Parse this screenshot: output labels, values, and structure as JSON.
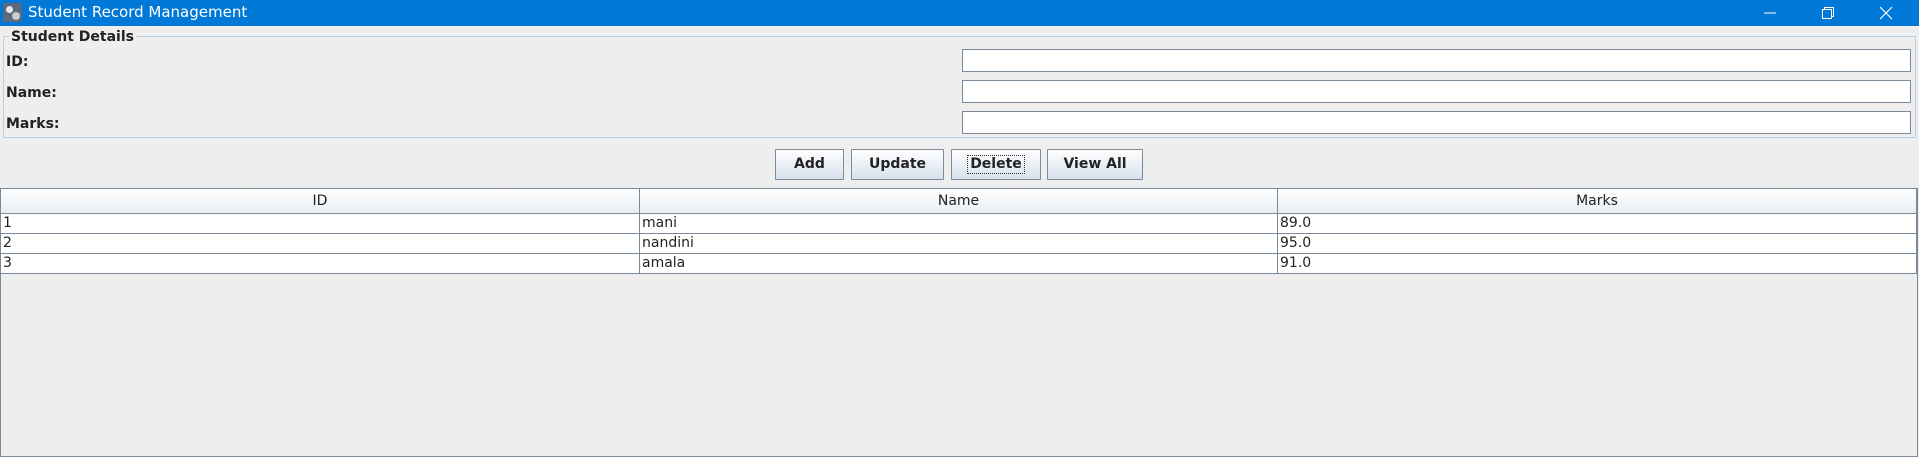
{
  "window": {
    "title": "Student Record Management",
    "buttons": {
      "minimize": "minimize-icon",
      "maximize": "restore-icon",
      "close": "close-icon"
    },
    "accent": "#0078d7"
  },
  "form": {
    "legend": "Student Details",
    "fields": [
      {
        "label": "ID:",
        "value": ""
      },
      {
        "label": "Name:",
        "value": ""
      },
      {
        "label": "Marks:",
        "value": ""
      }
    ]
  },
  "actions": {
    "add": "Add",
    "update": "Update",
    "delete": "Delete",
    "view_all": "View All"
  },
  "table": {
    "columns": [
      "ID",
      "Name",
      "Marks"
    ],
    "rows": [
      [
        "1",
        "mani",
        "89.0"
      ],
      [
        "2",
        "nandini",
        "95.0"
      ],
      [
        "3",
        "amala",
        "91.0"
      ]
    ]
  }
}
